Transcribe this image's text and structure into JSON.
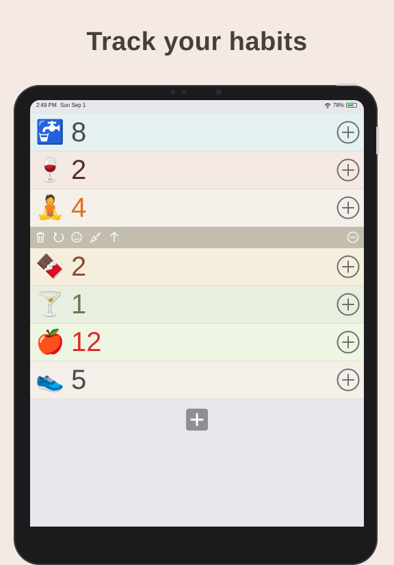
{
  "headline": "Track your habits",
  "status": {
    "time": "2:49 PM",
    "date": "Sun Sep 1",
    "battery_label": "78%",
    "battery_level": 0.78,
    "wifi_icon": "wifi-icon"
  },
  "habits": [
    {
      "emoji": "🚰",
      "count": "8",
      "bg": "#e5f0f0",
      "color": "#4a4a4a"
    },
    {
      "emoji": "🍷",
      "count": "2",
      "bg": "#f5e9e3",
      "color": "#5a2d2a"
    },
    {
      "emoji": "🧘",
      "count": "4",
      "bg": "#f5efe9",
      "color": "#e07020"
    }
  ],
  "toolbar": {
    "icons": [
      "trash-icon",
      "undo-icon",
      "smiley-icon",
      "paint-brush-icon",
      "arrow-up-icon"
    ],
    "collapse_icon": "minus-circle-icon",
    "bg": "#c2bdad"
  },
  "habits_below": [
    {
      "emoji": "🍫",
      "count": "2",
      "bg": "#f6eedd",
      "color": "#8a4e32"
    },
    {
      "emoji": "🍸",
      "count": "1",
      "bg": "#e8efe1",
      "color": "#6a7a52"
    },
    {
      "emoji": "🍎",
      "count": "12",
      "bg": "#eef5e3",
      "color": "#e02a2a"
    },
    {
      "emoji": "👟",
      "count": "5",
      "bg": "#f5efe9",
      "color": "#4a4a4a"
    }
  ],
  "add_button_icon": "plus-icon"
}
